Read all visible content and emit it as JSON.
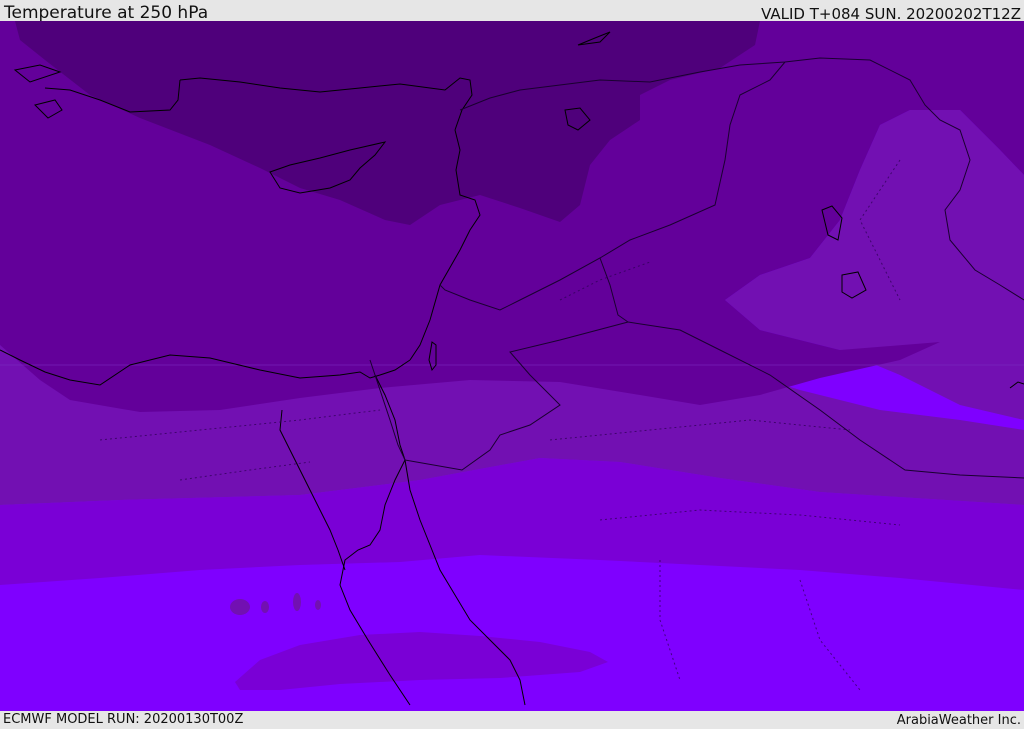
{
  "header": {
    "title": "Temperature at 250 hPa",
    "valid_time": "VALID T+084 SUN. 20200202T12Z"
  },
  "footer": {
    "model_run": "ECMWF MODEL RUN: 20200130T00Z",
    "credit": "ArabiaWeather Inc."
  },
  "map": {
    "field": "temperature",
    "level": "250 hPa",
    "colors": {
      "band_coldest": "#4f007b",
      "band_cold": "#63009a",
      "band_mid": "#7210b2",
      "band_warm": "#7a00d6",
      "band_warmest": "#7f00ff",
      "coastline": "#000000",
      "border": "#1a0030"
    }
  }
}
